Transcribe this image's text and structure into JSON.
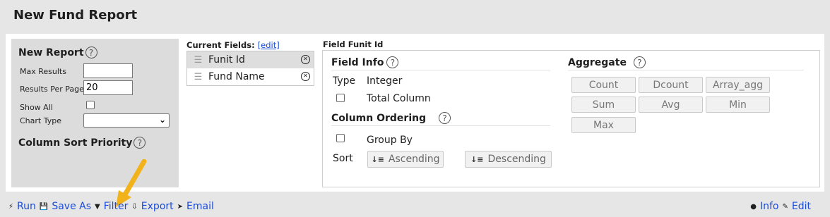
{
  "header": {
    "title": "New Fund Report"
  },
  "settings": {
    "new_report_label": "New Report",
    "max_results_label": "Max Results",
    "max_results_value": "",
    "results_per_page_label": "Results Per Page",
    "results_per_page_value": "20",
    "show_all_label": "Show All",
    "show_all_checked": false,
    "chart_type_label": "Chart Type",
    "chart_type_value": "",
    "column_sort_priority_label": "Column Sort Priority"
  },
  "current_fields": {
    "title": "Current Fields:",
    "edit_label": "[edit]",
    "items": [
      {
        "label": "Funit Id",
        "selected": true
      },
      {
        "label": "Fund Name",
        "selected": false
      }
    ]
  },
  "field_detail": {
    "title": "Field Funit Id",
    "field_info": {
      "heading": "Field Info",
      "type_label": "Type",
      "type_value": "Integer",
      "total_column_label": "Total Column"
    },
    "column_ordering": {
      "heading": "Column Ordering",
      "group_by_label": "Group By",
      "sort_label": "Sort",
      "ascending_label": "Ascending",
      "descending_label": "Descending"
    },
    "aggregate": {
      "heading": "Aggregate",
      "buttons": [
        "Count",
        "Dcount",
        "Array_agg",
        "Sum",
        "Avg",
        "Min",
        "Max"
      ]
    }
  },
  "footer": {
    "run_label": "Run",
    "save_as_label": "Save As",
    "filter_label": "Filter",
    "export_label": "Export",
    "email_label": "Email",
    "info_label": "Info",
    "edit_label": "Edit"
  },
  "colors": {
    "link": "#1a4bd6",
    "annotation_arrow": "#f2b21b",
    "panel_bg": "#dcdcdc"
  }
}
